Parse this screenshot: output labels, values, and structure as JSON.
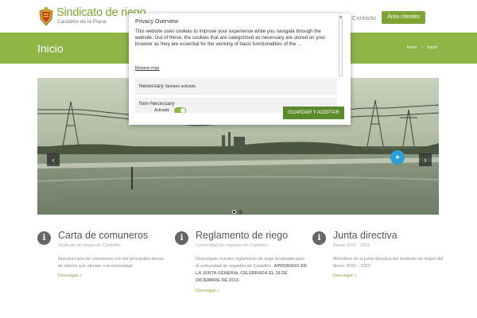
{
  "header": {
    "site_title": "Sindicato de riego",
    "site_subtitle": "Castellón de la Plana",
    "nav_contact": "Contacto",
    "nav_area": "Área clientes"
  },
  "banner": {
    "title": "Inicio",
    "breadcrumb": [
      "Inicio",
      "/",
      "Inicio"
    ]
  },
  "slider": {
    "active_slide": 1,
    "slide_count": 2
  },
  "features": [
    {
      "title": "Carta de comuneros",
      "subtitle": "Sindicato de riegos de Castellón",
      "text": "Nuestra carta de comuneros con los principales temas de interés que afectan a la comunidad.",
      "link": "Descargar »"
    },
    {
      "title": "Reglamento de riego",
      "subtitle": "Comunidad de regantes de Castellón",
      "text": "Descárgate nuestro reglamento de riego localizado para la comunidad de regantes de Castellón.",
      "bold": "APROBADO EN LA JUNTA GENERAL CELEBRADA EL 16 DE DICIEMBRE DE 2013.",
      "link": "Descargar »"
    },
    {
      "title": "Junta directiva",
      "subtitle": "Bienio 2022 - 2023",
      "text": "Miembros de la junta directiva del sindicato de riegos del bienio 2022 – 2023",
      "link": "Descargar »"
    }
  ],
  "cookie_modal": {
    "close": "×",
    "title": "Privacy Overview",
    "body": "This website uses cookies to improve your experience while you navigate through the website. Out of these, the cookies that are categorized as necessary are stored on your browser as they are essential for the working of basic functionalities of the ...",
    "show_more": "Mostrar más",
    "categories": [
      {
        "name": "Necessary",
        "status": "Siempre activado"
      },
      {
        "name": "Non-Necessary",
        "toggle_label": "Activado",
        "enabled": true
      }
    ],
    "accept": "GUARDAR Y ACEPTAR"
  },
  "colors": {
    "brand_green": "#7ea533",
    "banner_green": "#8db445",
    "accept_green": "#5c8a2a"
  }
}
